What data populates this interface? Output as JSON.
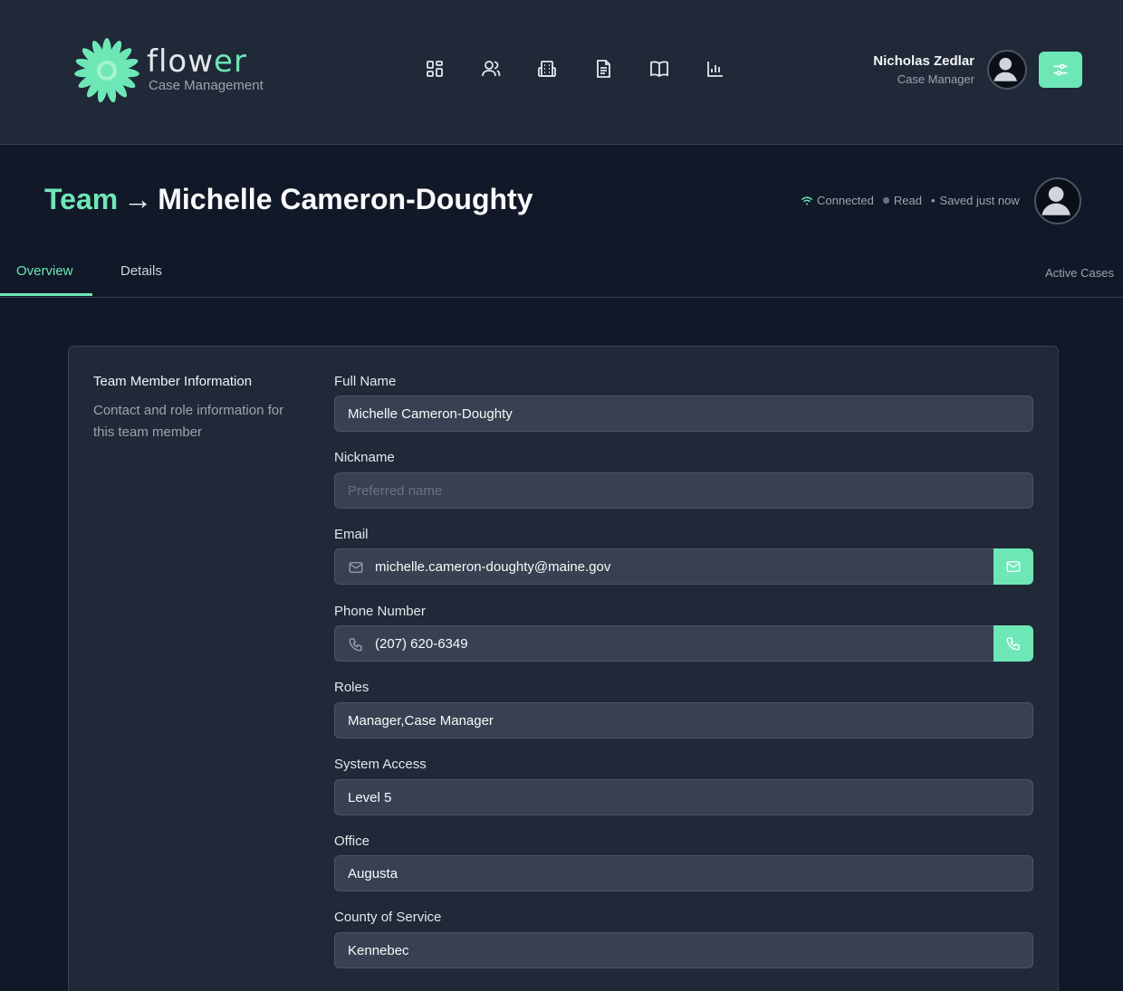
{
  "brand": {
    "name_prefix": "flow",
    "name_suffix": "er",
    "subtitle": "Case Management"
  },
  "nav": {
    "icons": [
      "dashboard-icon",
      "people-icon",
      "building-icon",
      "document-icon",
      "book-icon",
      "bar-chart-icon"
    ]
  },
  "user": {
    "name": "Nicholas Zedlar",
    "role": "Case Manager"
  },
  "title": {
    "crumb": "Team",
    "arrow": "→",
    "name": "Michelle Cameron-Doughty"
  },
  "status": {
    "connection": "Connected",
    "mode": "Read",
    "saved": "Saved just now"
  },
  "tabs": {
    "overview": "Overview",
    "details": "Details",
    "active_cases": "Active Cases"
  },
  "section": {
    "title": "Team Member Information",
    "description": "Contact and role information for this team member"
  },
  "fields": {
    "full_name": {
      "label": "Full Name",
      "value": "Michelle Cameron-Doughty"
    },
    "nickname": {
      "label": "Nickname",
      "placeholder": "Preferred name"
    },
    "email": {
      "label": "Email",
      "value": "michelle.cameron-doughty@maine.gov"
    },
    "phone": {
      "label": "Phone Number",
      "value": "(207) 620-6349"
    },
    "roles": {
      "label": "Roles",
      "value": "Manager,Case Manager"
    },
    "system_access": {
      "label": "System Access",
      "value": "Level 5"
    },
    "office": {
      "label": "Office",
      "value": "Augusta"
    },
    "county": {
      "label": "County of Service",
      "value": "Kennebec"
    }
  },
  "colors": {
    "accent": "#6ee7b7",
    "background": "#111827",
    "panel": "#1f2937",
    "input": "#374151"
  }
}
